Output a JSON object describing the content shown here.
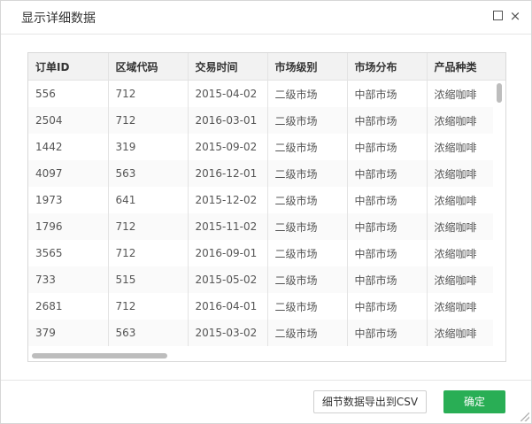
{
  "dialog": {
    "title": "显示详细数据",
    "maximize_icon": "maximize-icon",
    "close_icon": "×"
  },
  "table": {
    "columns": [
      "订单ID",
      "区域代码",
      "交易时间",
      "市场级别",
      "市场分布",
      "产品种类"
    ],
    "rows": [
      [
        "556",
        "712",
        "2015-04-02",
        "二级市场",
        "中部市场",
        "浓缩咖啡"
      ],
      [
        "2504",
        "712",
        "2016-03-01",
        "二级市场",
        "中部市场",
        "浓缩咖啡"
      ],
      [
        "1442",
        "319",
        "2015-09-02",
        "二级市场",
        "中部市场",
        "浓缩咖啡"
      ],
      [
        "4097",
        "563",
        "2016-12-01",
        "二级市场",
        "中部市场",
        "浓缩咖啡"
      ],
      [
        "1973",
        "641",
        "2015-12-02",
        "二级市场",
        "中部市场",
        "浓缩咖啡"
      ],
      [
        "1796",
        "712",
        "2015-11-02",
        "二级市场",
        "中部市场",
        "浓缩咖啡"
      ],
      [
        "3565",
        "712",
        "2016-09-01",
        "二级市场",
        "中部市场",
        "浓缩咖啡"
      ],
      [
        "733",
        "515",
        "2015-05-02",
        "二级市场",
        "中部市场",
        "浓缩咖啡"
      ],
      [
        "2681",
        "712",
        "2016-04-01",
        "二级市场",
        "中部市场",
        "浓缩咖啡"
      ],
      [
        "379",
        "563",
        "2015-03-02",
        "二级市场",
        "中部市场",
        "浓缩咖啡"
      ]
    ]
  },
  "footer": {
    "export_label": "细节数据导出到CSV",
    "ok_label": "确定"
  },
  "colors": {
    "ok_button": "#29ae55",
    "header_bg": "#f2f2f2"
  }
}
